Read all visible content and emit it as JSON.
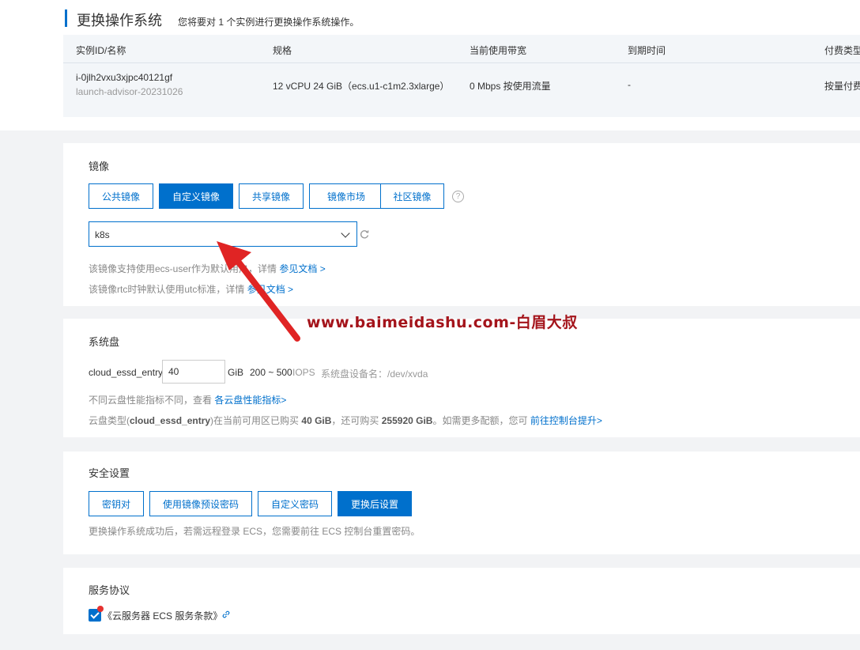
{
  "header": {
    "title": "更换操作系统",
    "subtitle": "您将要对 1 个实例进行更换操作系统操作。"
  },
  "instance_table": {
    "columns": [
      "实例ID/名称",
      "规格",
      "当前使用带宽",
      "到期时间",
      "付费类型"
    ],
    "row": {
      "instance_id": "i-0jlh2vxu3xjpc40121gf",
      "instance_name": "launch-advisor-20231026",
      "spec": "12 vCPU 24 GiB（ecs.u1-c1m2.3xlarge）",
      "bandwidth": "0 Mbps 按使用流量",
      "expire": "-",
      "billing": "按量付费"
    }
  },
  "image": {
    "title": "镜像",
    "tabs": [
      "公共镜像",
      "自定义镜像",
      "共享镜像",
      "镜像市场",
      "社区镜像"
    ],
    "active_tab": "自定义镜像",
    "help_glyph": "?",
    "selected": "k8s",
    "note1_prefix": "该镜像支持使用ecs-user作为默认用户，详情 ",
    "note1_link": "参见文档 >",
    "note2_prefix": "该镜像rtc时钟默认使用utc标准，详情 ",
    "note2_link": "参见文档 >"
  },
  "watermark": "www.baimeidashu.com-白眉大叔",
  "system_disk": {
    "title": "系统盘",
    "type": "cloud_essd_entry",
    "size": "40",
    "unit": "GiB",
    "iops_range": "200 ~ 500",
    "iops_label": "IOPS",
    "device_label": "系统盘设备名：/dev/xvda",
    "note1_prefix": "不同云盘性能指标不同，查看 ",
    "note1_link": "各云盘性能指标>",
    "note2_a": "云盘类型(",
    "note2_type": "cloud_essd_entry",
    "note2_b": ")在当前可用区已购买 ",
    "note2_bought": "40 GiB",
    "note2_c": "，还可购买 ",
    "note2_remain": "255920 GiB",
    "note2_d": "。如需更多配额，您可 ",
    "note2_link": "前往控制台提升>"
  },
  "security": {
    "title": "安全设置",
    "options": [
      "密钥对",
      "使用镜像预设密码",
      "自定义密码",
      "更换后设置"
    ],
    "active_option": "更换后设置",
    "note": "更换操作系统成功后，若需远程登录 ECS，您需要前往 ECS 控制台重置密码。"
  },
  "agreement": {
    "title": "服务协议",
    "text": "《云服务器 ECS 服务条款》",
    "checked": true
  },
  "colors": {
    "accent": "#0070cc",
    "watermark": "#a4141b",
    "arrow": "#e02424"
  },
  "icons": [
    "help-circle-icon",
    "chevron-down-icon",
    "refresh-icon",
    "link-icon",
    "check-icon",
    "red-arrow-annotation"
  ]
}
